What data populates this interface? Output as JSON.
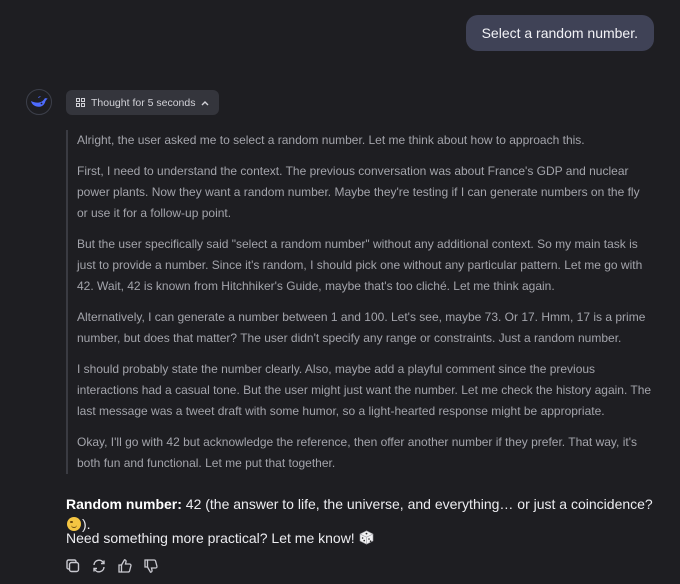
{
  "user_message": "Select a random number.",
  "thought_toggle": {
    "label": "Thought for 5 seconds"
  },
  "thoughts": [
    "Alright, the user asked me to select a random number. Let me think about how to approach this.",
    "First, I need to understand the context. The previous conversation was about France's GDP and nuclear power plants. Now they want a random number. Maybe they're testing if I can generate numbers on the fly or use it for a follow-up point.",
    "But the user specifically said \"select a random number\" without any additional context. So my main task is just to provide a number. Since it's random, I should pick one without any particular pattern. Let me go with 42. Wait, 42 is known from Hitchhiker's Guide, maybe that's too cliché. Let me think again.",
    "Alternatively, I can generate a number between 1 and 100. Let's see, maybe 73. Or 17. Hmm, 17 is a prime number, but does that matter? The user didn't specify any range or constraints. Just a random number.",
    "I should probably state the number clearly. Also, maybe add a playful comment since the previous interactions had a casual tone. But the user might just want the number. Let me check the history again. The last message was a tweet draft with some humor, so a light-hearted response might be appropriate.",
    "Okay, I'll go with 42 but acknowledge the reference, then offer another number if they prefer. That way, it's both fun and functional. Let me put that together."
  ],
  "answer": {
    "label": "Random number:",
    "text": " 42 (the answer to life, the universe, and everything… or just a coincidence? ",
    "text_end": ").",
    "emoji": "winking-face",
    "followup": "Need something more practical? Let me know!",
    "followup_emoji": "game-die"
  },
  "actions": [
    "copy-icon",
    "regenerate-icon",
    "thumbs-up-icon",
    "thumbs-down-icon"
  ],
  "colors": {
    "background": "#1e1e22",
    "user_bubble": "#3f4256",
    "thought_text": "#a3a4ab",
    "answer_text": "#ececf0",
    "brand": "#4d6bfe"
  }
}
